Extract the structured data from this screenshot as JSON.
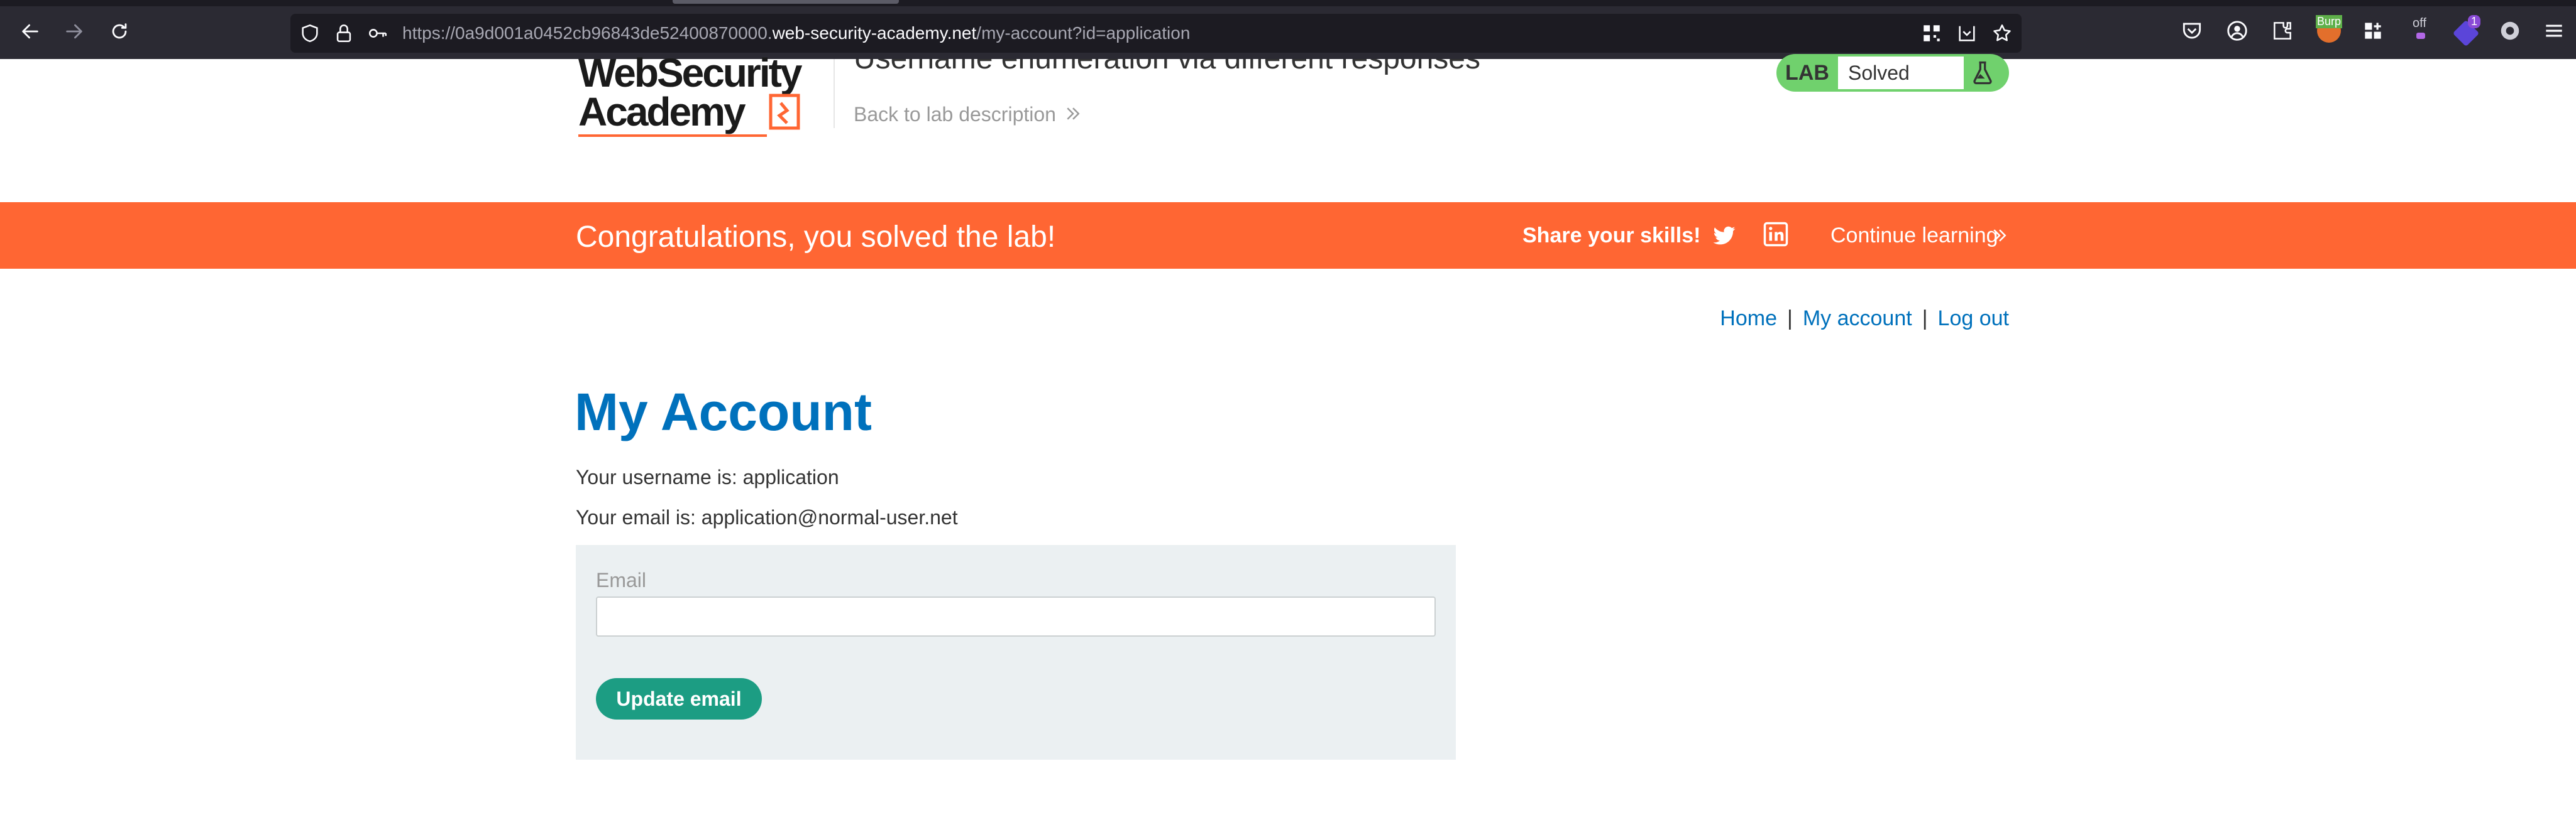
{
  "browser": {
    "url_prefix": "https://0a9d001a0452cb96843de52400870000.",
    "url_host": "web-security-academy.net",
    "url_path": "/my-account?id=application",
    "extension_labels": {
      "burp": "Burp",
      "off": "off",
      "badge_count": "1"
    }
  },
  "lab_header": {
    "logo_line1": "WebSecurity",
    "logo_line2": "Academy",
    "title": "Username enumeration via different responses",
    "back_link": "Back to lab description",
    "badge_label": "LAB",
    "badge_status": "Solved"
  },
  "banner": {
    "message": "Congratulations, you solved the lab!",
    "share_label": "Share your skills!",
    "continue_label": "Continue learning"
  },
  "nav": {
    "home": "Home",
    "separator": "|",
    "my_account": "My account",
    "log_out": "Log out"
  },
  "account": {
    "title": "My Account",
    "username_line": "Your username is: application",
    "email_line": "Your email is: application@normal-user.net",
    "email_label": "Email",
    "email_value": "",
    "update_button": "Update email"
  },
  "colors": {
    "accent_orange": "#ff6633",
    "link_blue": "#0071bc",
    "button_green": "#1c9d83",
    "badge_green": "#70d16d",
    "form_bg": "#ebf0f2"
  }
}
